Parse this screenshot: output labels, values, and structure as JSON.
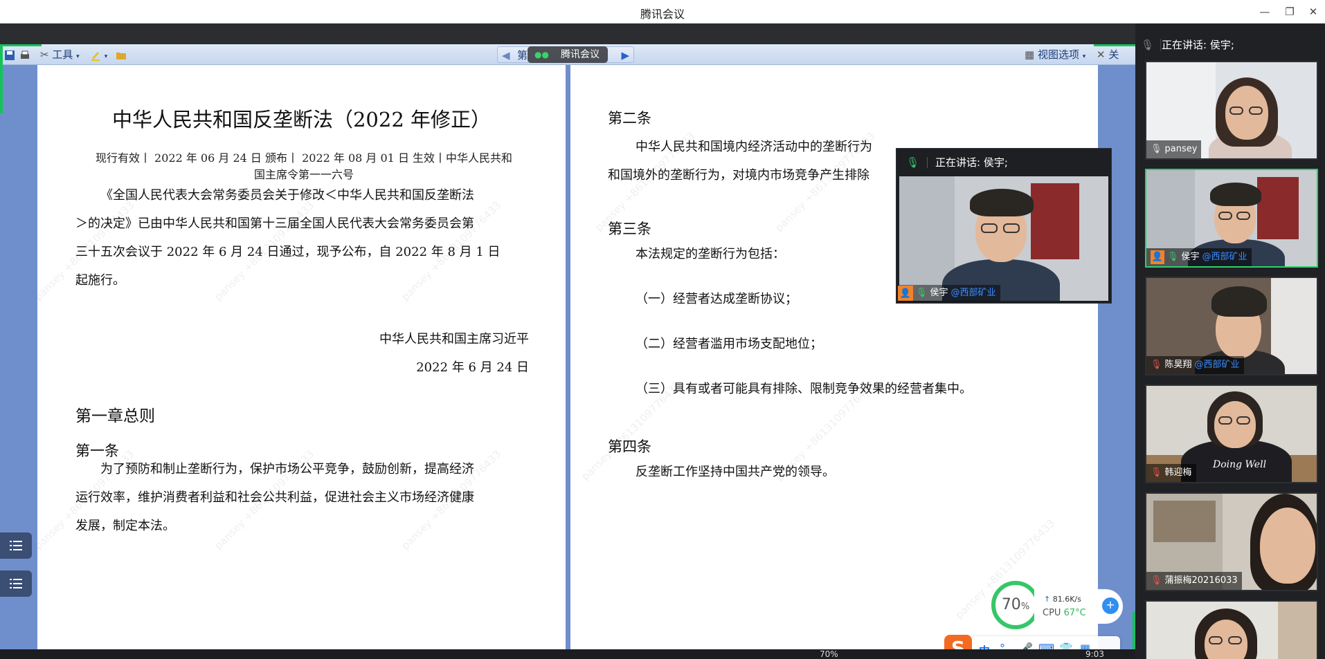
{
  "window": {
    "title": "腾讯会议"
  },
  "toolbar": {
    "tools_label": "工具",
    "nav_label": "第",
    "meeting_badge": "腾讯会议",
    "view_options_label": "视图选项",
    "close_label": "关"
  },
  "document": {
    "title": "中华人民共和国反垄断法（2022 年修正）",
    "meta_line1": "现行有效丨 2022 年 06 月 24 日 颁布丨 2022 年 08 月 01 日 生效丨中华人民共和",
    "meta_line2": "国主席令第一一六号",
    "intro_lines": [
      "《全国人民代表大会常务委员会关于修改＜中华人民共和国反垄断法",
      "＞的决定》已由中华人民共和国第十三届全国人民代表大会常务委员会第",
      "三十五次会议于 2022 年 6 月 24 日通过，现予公布，自 2022 年 8 月 1 日",
      "起施行。"
    ],
    "signature": "中华人民共和国主席习近平",
    "signature_date": "2022 年 6 月 24 日",
    "chapter1": "第一章总则",
    "article1": "第一条",
    "article1_lines": [
      "为了预防和制止垄断行为，保护市场公平竞争，鼓励创新，提高经济",
      "运行效率，维护消费者利益和社会公共利益，促进社会主义市场经济健康",
      "发展，制定本法。"
    ],
    "article2": "第二条",
    "article2_lines": [
      "中华人民共和国境内经济活动中的垄断行为",
      "和国境外的垄断行为，对境内市场竞争产生排除"
    ],
    "article3": "第三条",
    "article3_intro": "本法规定的垄断行为包括：",
    "article3_items": [
      "（一）经营者达成垄断协议；",
      "（二）经营者滥用市场支配地位；",
      "（三）具有或者可能具有排除、限制竞争效果的经营者集中。"
    ],
    "article4": "第四条",
    "article4_text": "反垄断工作坚持中国共产党的领导。",
    "watermark": "pansey +8613109776433"
  },
  "speaking": {
    "label": "正在讲话: 侯宇;"
  },
  "float_video": {
    "name": "侯宇",
    "org": "@西部矿业"
  },
  "participants": [
    {
      "name": "pansey",
      "org": ""
    },
    {
      "name": "侯宇",
      "org": "@西部矿业"
    },
    {
      "name": "陈昊翔",
      "org": "@西部矿业"
    },
    {
      "name": "韩迎梅",
      "org": ""
    },
    {
      "name": "蒲振梅20216033",
      "org": ""
    },
    {
      "name": "",
      "org": ""
    }
  ],
  "shirt_text": "Doing Well",
  "monitor": {
    "percent": "70",
    "percent_unit": "%",
    "net_speed": "81.6K/s",
    "cpu_label": "CPU",
    "cpu_temp": "67°C"
  },
  "ime": {
    "lang": "中"
  },
  "taskbar": {
    "zoom": "70%",
    "time": "9:03"
  },
  "colors": {
    "accent_green": "#16c25c",
    "org_blue": "#3b8eff"
  }
}
